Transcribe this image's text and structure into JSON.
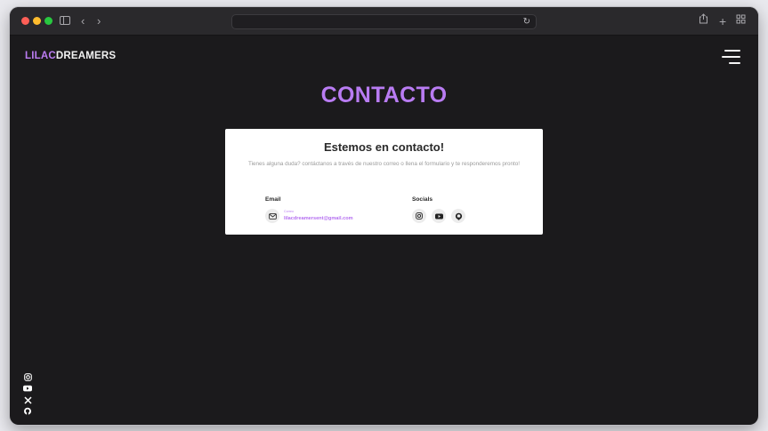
{
  "browser": {
    "traffic_lights": [
      "close",
      "minimize",
      "zoom"
    ],
    "nav_icons": [
      "sidebar-icon",
      "back-icon",
      "forward-icon"
    ],
    "right_icons": [
      "share-icon",
      "new-tab-icon",
      "tab-overview-icon"
    ],
    "address_value": ""
  },
  "header": {
    "logo_part1": "LILAC",
    "logo_part2": "DREAMERS",
    "menu_icon": "hamburger-icon"
  },
  "main": {
    "title": "CONTACTO",
    "card": {
      "title": "Estemos en contacto!",
      "subtitle": "Tienes alguna duda? contáctanos a través de nuestro correo o llena el formulario y te responderemos pronto!",
      "email_label": "Email",
      "email_small": "Correo",
      "email_address": "lilacdreamersent@gmail.com",
      "socials_label": "Socials",
      "social_icons": [
        "instagram-icon",
        "youtube-icon",
        "github-icon"
      ]
    }
  },
  "side_social_icons": [
    "instagram-icon",
    "youtube-icon",
    "x-icon",
    "github-icon"
  ],
  "colors": {
    "accent": "#b97cf3",
    "page_bg": "#1b1a1c",
    "card_bg": "#ffffff"
  }
}
